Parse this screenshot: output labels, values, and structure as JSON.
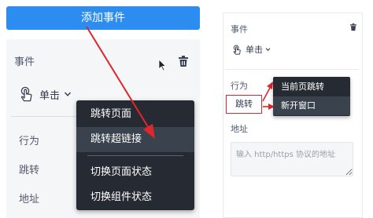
{
  "left": {
    "add_event_label": "添加事件",
    "event_label": "事件",
    "trigger_value": "单击",
    "properties": [
      "行为",
      "跳转",
      "地址"
    ],
    "menu": [
      "跳转页面",
      "跳转超链接",
      "切换页面状态",
      "切换组件状态"
    ],
    "highlighted_menu_item": "跳转超链接"
  },
  "right": {
    "event_label": "事件",
    "trigger_value": "单击",
    "action_label": "行为",
    "jump_label": "跳转",
    "address_label": "地址",
    "url_placeholder": "输入 http/https 协议的地址",
    "menu": [
      "当前页跳转",
      "新开窗口"
    ]
  },
  "colors": {
    "primary": "#2d8cf0",
    "annotation_red": "#e0262d",
    "menu_bg": "#262b33",
    "menu_highlight": "#3a424d"
  },
  "icons": [
    "trash-icon",
    "hand-pointer-icon",
    "chevron-down-icon",
    "mouse-cursor-icon",
    "arrow-icon"
  ]
}
